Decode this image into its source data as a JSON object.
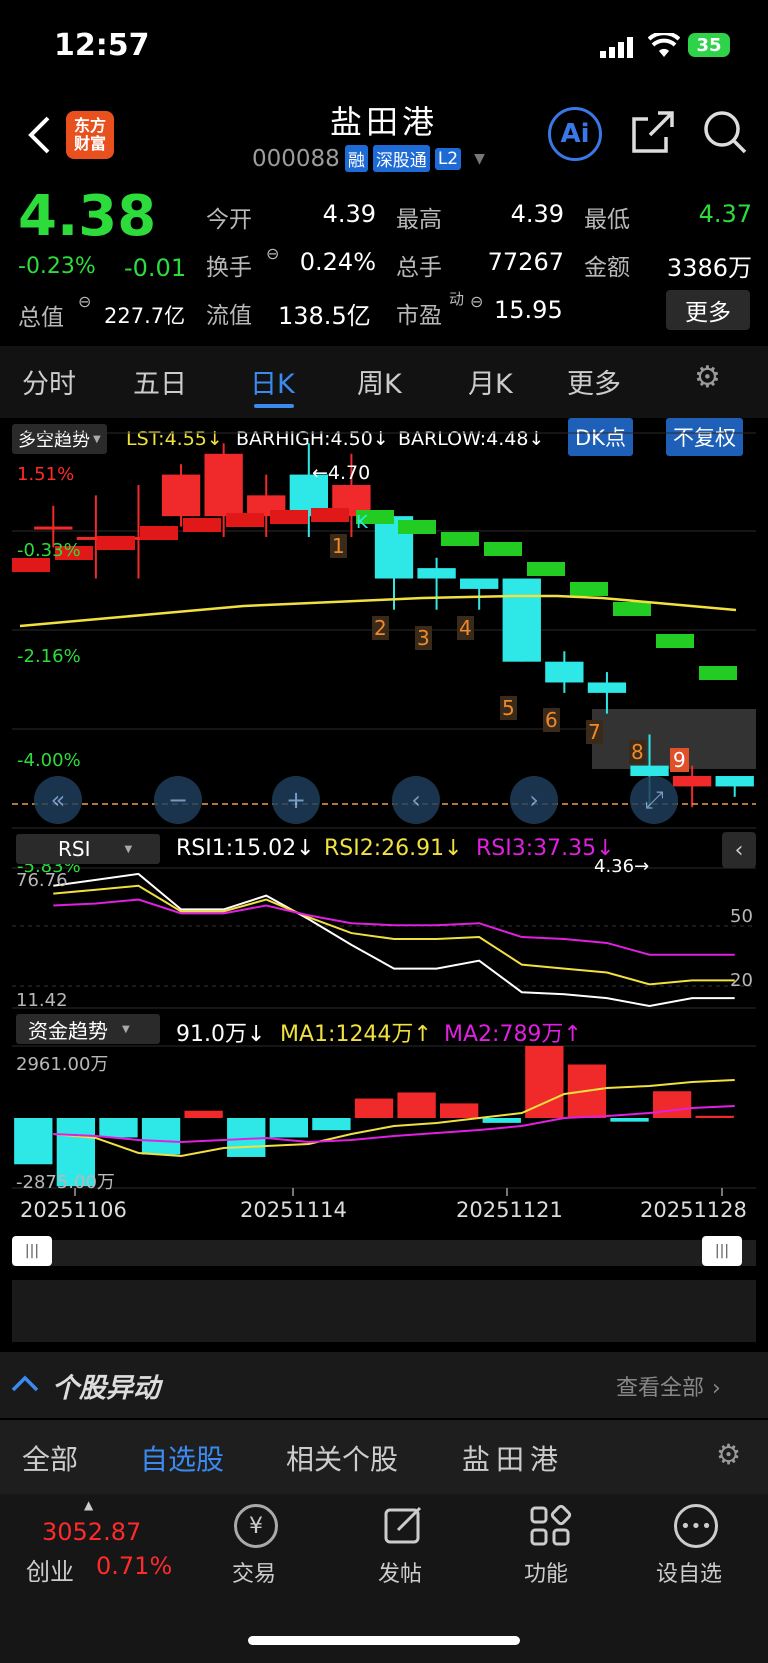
{
  "status": {
    "time": "12:57",
    "battery": "35"
  },
  "header": {
    "title": "盐田港",
    "code": "000088",
    "badges": [
      "融",
      "深股通",
      "L2"
    ],
    "logo_text": [
      "东方",
      "财富"
    ],
    "ai_label": "Ai"
  },
  "quote": {
    "price": "4.38",
    "change_pct": "-0.23%",
    "change": "-0.01",
    "open_label": "今开",
    "open": "4.39",
    "high_label": "最高",
    "high": "4.39",
    "low_label": "最低",
    "low": "4.37",
    "turnover_label": "换手",
    "turnover": "0.24%",
    "volume_label": "总手",
    "volume": "77267",
    "amount_label": "金额",
    "amount": "3386万",
    "mktcap_label": "总值",
    "mktcap": "227.7亿",
    "float_label": "流值",
    "float": "138.5亿",
    "pe_label": "市盈",
    "pe_sup": "动",
    "pe": "15.95",
    "more_label": "更多"
  },
  "tabs": [
    "分时",
    "五日",
    "日K",
    "周K",
    "月K",
    "更多"
  ],
  "active_tab": "日K",
  "indicator_bar": {
    "dropdown": "多空趋势",
    "lst": "LST:4.55",
    "barhigh": "BARHIGH:4.50",
    "barlow": "BARLOW:4.48",
    "dk_button": "DK点",
    "fq_button": "不复权"
  },
  "chart_data": [
    {
      "type": "candlestick",
      "y_labels": [
        "1.51%",
        "-0.33%",
        "-2.16%",
        "-4.00%",
        "-5.83%"
      ],
      "annotations": {
        "max": "4.70",
        "min": "4.36",
        "k_marker": "K"
      },
      "markers": [
        "1",
        "2",
        "3",
        "4",
        "5",
        "6",
        "7",
        "8",
        "9"
      ],
      "candles": [
        {
          "o": 4.63,
          "c": 4.63,
          "h": 4.65,
          "l": 4.61
        },
        {
          "o": 4.62,
          "c": 4.62,
          "h": 4.66,
          "l": 4.58
        },
        {
          "o": 4.62,
          "c": 4.62,
          "h": 4.67,
          "l": 4.58
        },
        {
          "o": 4.64,
          "c": 4.68,
          "h": 4.69,
          "l": 4.63
        },
        {
          "o": 4.64,
          "c": 4.7,
          "h": 4.71,
          "l": 4.62
        },
        {
          "o": 4.64,
          "c": 4.66,
          "h": 4.68,
          "l": 4.62
        },
        {
          "o": 4.68,
          "c": 4.64,
          "h": 4.71,
          "l": 4.62
        },
        {
          "o": 4.64,
          "c": 4.67,
          "h": 4.7,
          "l": 4.62
        },
        {
          "o": 4.64,
          "c": 4.58,
          "h": 4.64,
          "l": 4.55
        },
        {
          "o": 4.59,
          "c": 4.58,
          "h": 4.6,
          "l": 4.55
        },
        {
          "o": 4.58,
          "c": 4.57,
          "h": 4.58,
          "l": 4.55
        },
        {
          "o": 4.58,
          "c": 4.5,
          "h": 4.58,
          "l": 4.5
        },
        {
          "o": 4.5,
          "c": 4.48,
          "h": 4.51,
          "l": 4.47
        },
        {
          "o": 4.48,
          "c": 4.47,
          "h": 4.49,
          "l": 4.45
        },
        {
          "o": 4.4,
          "c": 4.39,
          "h": 4.43,
          "l": 4.36
        },
        {
          "o": 4.38,
          "c": 4.39,
          "h": 4.4,
          "l": 4.36
        },
        {
          "o": 4.39,
          "c": 4.38,
          "h": 4.39,
          "l": 4.37
        }
      ]
    },
    {
      "type": "line",
      "name": "RSI",
      "labels": {
        "rsi1": "RSI1:15.02",
        "rsi2": "RSI2:26.91",
        "rsi3": "RSI3:37.35"
      },
      "y_labels": [
        "76.76",
        "50",
        "20",
        "11.42"
      ],
      "series": [
        {
          "name": "RSI1",
          "color": "#ffffff",
          "values": [
            72,
            75,
            78,
            60,
            60,
            67,
            55,
            42,
            30,
            30,
            34,
            18,
            17,
            15,
            11,
            15,
            15
          ]
        },
        {
          "name": "RSI2",
          "color": "#f0e040",
          "values": [
            68,
            70,
            72,
            59,
            59,
            65,
            56,
            48,
            45,
            45,
            46,
            32,
            30,
            28,
            22,
            24,
            24
          ]
        },
        {
          "name": "RSI3",
          "color": "#e020e0",
          "values": [
            62,
            63,
            65,
            58,
            58,
            62,
            57,
            53,
            52,
            52,
            53,
            46,
            45,
            43,
            37,
            37,
            37
          ]
        }
      ]
    },
    {
      "type": "bar",
      "name": "资金趋势",
      "labels": {
        "value": "91.0万",
        "ma1": "MA1:1244万",
        "ma2": "MA2:789万"
      },
      "y_labels": [
        "2961.00万",
        "-2875.00万"
      ],
      "x_labels": [
        "20251106",
        "20251114",
        "20251121",
        "20251128"
      ],
      "values": [
        -1900,
        -2800,
        -800,
        -1500,
        300,
        -1600,
        -800,
        -500,
        800,
        1050,
        600,
        -200,
        2961,
        2200,
        -150,
        1100,
        91
      ]
    }
  ],
  "section": {
    "title": "个股异动",
    "view_all": "查看全部"
  },
  "bottom_tabs": [
    "全部",
    "自选股",
    "相关个股",
    "盐田港"
  ],
  "bottom_active": "自选股",
  "dock": {
    "index_value": "3052.87",
    "index_name": "创业",
    "index_change": "0.71%",
    "items": [
      "交易",
      "发帖",
      "功能",
      "设自选"
    ]
  }
}
